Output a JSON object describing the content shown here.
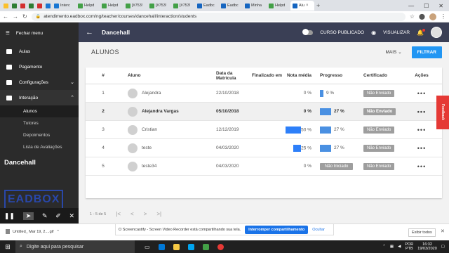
{
  "browser": {
    "tabs": [
      {
        "label": "",
        "color": "#fbc02d"
      },
      {
        "label": "",
        "color": "#2e7d32"
      },
      {
        "label": "",
        "color": "#d32f2f"
      },
      {
        "label": "",
        "color": "#2e7d32"
      },
      {
        "label": "",
        "color": "#d32f2f"
      },
      {
        "label": "",
        "color": "#1976d2"
      },
      {
        "label": "Interc",
        "color": "#1976d2"
      },
      {
        "label": "Helpd",
        "color": "#43a047"
      },
      {
        "label": "Helpd",
        "color": "#43a047"
      },
      {
        "label": "[#753!",
        "color": "#43a047"
      },
      {
        "label": "[#753!",
        "color": "#43a047"
      },
      {
        "label": "[#753!",
        "color": "#43a047"
      },
      {
        "label": "Eadbc",
        "color": "#1565c0"
      },
      {
        "label": "Eadbc",
        "color": "#1565c0"
      },
      {
        "label": "Minha",
        "color": "#1565c0"
      },
      {
        "label": "Helpd",
        "color": "#43a047"
      },
      {
        "label": "Alu",
        "color": "#1565c0",
        "active": true
      }
    ],
    "url": "atendimento.eadbox.com/ng/teacher/courses/dancehall/interaction/students"
  },
  "sidebar": {
    "menu_label": "Fechar menu",
    "items": [
      {
        "label": "Aulas"
      },
      {
        "label": "Pagamento"
      },
      {
        "label": "Configurações"
      },
      {
        "label": "Interação"
      }
    ],
    "subitems": [
      {
        "label": "Alunos",
        "active": true
      },
      {
        "label": "Tutores"
      },
      {
        "label": "Depoimentos"
      },
      {
        "label": "Lista de Avaliações"
      }
    ],
    "course_name": "Dancehall",
    "logo_text": "EADBOX"
  },
  "header": {
    "title": "Dancehall",
    "published_label": "CURSO PUBLICADO",
    "view_label": "VISUALIZAR"
  },
  "subheader": {
    "title": "ALUNOS",
    "more_label": "MAIS",
    "filter_label": "FILTRAR"
  },
  "table": {
    "headers": {
      "num": "#",
      "name": "Aluno",
      "date": "Data da Matrícula",
      "final": "Finalizado em",
      "nota": "Nota média",
      "prog": "Progresso",
      "cert": "Certificado",
      "acts": "Ações"
    },
    "rows": [
      {
        "num": "1",
        "name": "Alejandra",
        "date": "22/10/2018",
        "final": "",
        "nota": "0 %",
        "nota_pct": 0,
        "prog": "9 %",
        "prog_pct": 9,
        "cert": "Não Enviado",
        "acts": "•••"
      },
      {
        "num": "2",
        "name": "Alejandra Vargas",
        "date": "05/10/2018",
        "final": "",
        "nota": "0 %",
        "nota_pct": 0,
        "prog": "27 %",
        "prog_pct": 27,
        "cert": "Não Enviado",
        "acts": "•••"
      },
      {
        "num": "3",
        "name": "Cristian",
        "date": "12/12/2019",
        "final": "",
        "nota": "50 %",
        "nota_pct": 50,
        "prog": "27 %",
        "prog_pct": 27,
        "cert": "Não Enviado",
        "acts": "•••"
      },
      {
        "num": "4",
        "name": "teste",
        "date": "04/03/2020",
        "final": "",
        "nota": "25 %",
        "nota_pct": 25,
        "prog": "27 %",
        "prog_pct": 27,
        "cert": "Não Enviado",
        "acts": "•••"
      },
      {
        "num": "5",
        "name": "teste34",
        "date": "04/03/2020",
        "final": "",
        "nota": "0 %",
        "nota_pct": 0,
        "prog": "Não Iniciado",
        "prog_pct": 0,
        "cert": "Não Enviado",
        "acts": "•••"
      }
    ]
  },
  "pager": {
    "range": "1 - 5 de 5"
  },
  "feedback_label": "Feedback",
  "share_bar": {
    "text": "O Screencastify - Screen Video Recorder está compartilhando sua tela.",
    "stop_label": "Interromper compartilhamento",
    "hide_label": "Ocultar"
  },
  "downloads": {
    "file": "Untitled_ Mar 19, 2....gif",
    "show_all": "Exibir todos"
  },
  "taskbar": {
    "search_placeholder": "Digite aqui para pesquisar",
    "lang": "POR",
    "layout": "PTB",
    "time": "16:32",
    "date": "19/03/2020"
  }
}
